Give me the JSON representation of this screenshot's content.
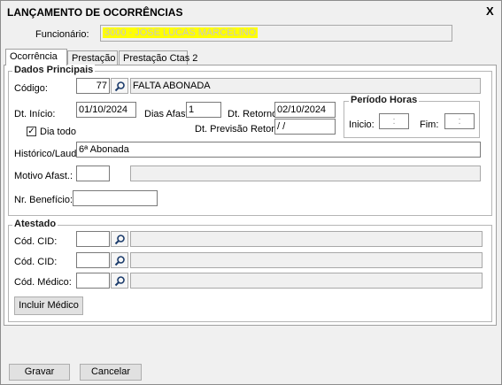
{
  "window": {
    "title": "LANÇAMENTO DE OCORRÊNCIAS",
    "close_label": "X"
  },
  "funcionario": {
    "label": "Funcionário:",
    "value": "3000 - JOSE LUCAS MARCELINO"
  },
  "tabs": [
    {
      "label": "Ocorrência",
      "active": true
    },
    {
      "label": "Prestação Ctas",
      "active": false
    },
    {
      "label": "Prestação Ctas 2",
      "active": false
    }
  ],
  "dados_principais": {
    "title": "Dados Principais",
    "codigo_label": "Código:",
    "codigo_value": "77",
    "codigo_desc": "FALTA ABONADA",
    "dt_inicio_label": "Dt. Início:",
    "dt_inicio_value": "01/10/2024",
    "dias_afast_label": "Dias Afast.",
    "dias_afast_value": "1",
    "dt_retorno_label": "Dt. Retorno:",
    "dt_retorno_value": "02/10/2024",
    "dia_todo_label": "Dia todo",
    "dia_todo_checked": "✓",
    "dt_previsao_label": "Dt. Previsão Retorno:",
    "dt_previsao_value": " /  /",
    "periodo_horas": {
      "title": "Período Horas",
      "inicio_label": "Inicio:",
      "inicio_value": ":",
      "fim_label": "Fim:",
      "fim_value": ":"
    },
    "historico_label": "Histórico/Laudo:",
    "historico_value": "6ª Abonada",
    "motivo_label": "Motivo Afast.:",
    "motivo_value": "",
    "nr_beneficio_label": "Nr. Benefício:",
    "nr_beneficio_value": ""
  },
  "atestado": {
    "title": "Atestado",
    "cid1_label": "Cód. CID:",
    "cid2_label": "Cód. CID:",
    "medico_label": "Cód. Médico:",
    "incluir_medico_label": "Incluir Médico"
  },
  "footer": {
    "gravar_label": "Gravar",
    "cancelar_label": "Cancelar"
  },
  "colors": {
    "highlight": "#ffff00",
    "panel_bg": "#ffffff",
    "window_bg": "#f0f0f0"
  }
}
